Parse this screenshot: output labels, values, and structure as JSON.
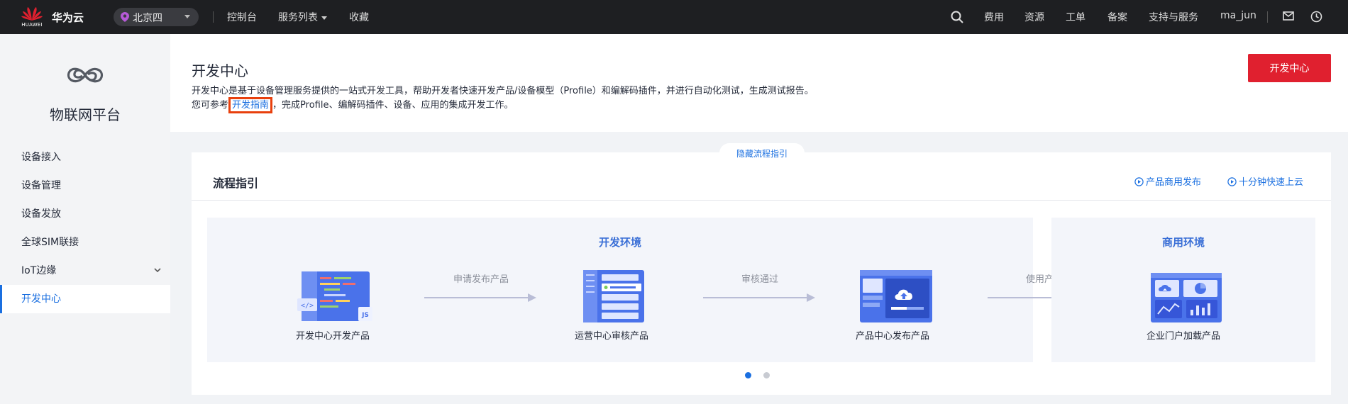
{
  "topbar": {
    "logo_text": "HUAWEI",
    "brand": "华为云",
    "region": "北京四",
    "nav": [
      "控制台",
      "服务列表",
      "收藏"
    ],
    "right_nav": [
      "费用",
      "资源",
      "工单",
      "备案",
      "支持与服务"
    ],
    "user": "ma_jun"
  },
  "sidebar": {
    "title": "物联网平台",
    "items": [
      {
        "label": "设备接入"
      },
      {
        "label": "设备管理"
      },
      {
        "label": "设备发放"
      },
      {
        "label": "全球SIM联接"
      },
      {
        "label": "IoT边缘"
      },
      {
        "label": "开发中心"
      }
    ],
    "active": "开发中心"
  },
  "header": {
    "title": "开发中心",
    "desc": "开发中心是基于设备管理服务提供的一站式开发工具，帮助开发者快速开发产品/设备模型（Profile）和编解码插件，并进行自动化测试，生成测试报告。",
    "desc2_prefix": "您可参考",
    "desc2_link": "开发指南",
    "desc2_suffix": "，完成Profile、编解码插件、设备、应用的集成开发工作。",
    "button": "开发中心"
  },
  "guide": {
    "hide_label": "隐藏流程指引",
    "title": "流程指引",
    "link1": "产品商用发布",
    "link2": "十分钟快速上云",
    "dev_zone": "开发环境",
    "biz_zone": "商用环境",
    "steps": [
      "开发中心开发产品",
      "运营中心审核产品",
      "产品中心发布产品",
      "企业门户加载产品"
    ],
    "arrows": [
      "申请发布产品",
      "审核通过",
      "使用产品"
    ],
    "pager_active": 0
  },
  "colors": {
    "accent": "#1a6fe0",
    "primary_button": "#e0202f",
    "topbar": "#1e1f22",
    "illustration": "#4a72ea"
  }
}
